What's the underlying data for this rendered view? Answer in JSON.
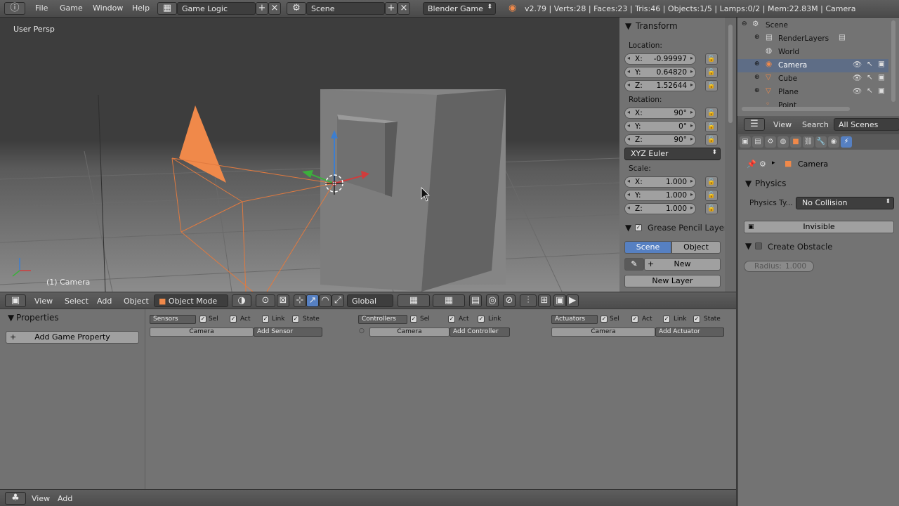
{
  "topbar": {
    "menus": [
      "File",
      "Game",
      "Window",
      "Help"
    ],
    "screen_layout": "Game Logic",
    "scene": "Scene",
    "engine": "Blender Game",
    "status": "v2.79 | Verts:28 | Faces:23 | Tris:46 | Objects:1/5 | Lamps:0/2 | Mem:22.83M | Camera"
  },
  "viewport": {
    "view_label": "User Persp",
    "object_label": "(1) Camera"
  },
  "transform_panel": {
    "title": "Transform",
    "location_label": "Location:",
    "location": [
      {
        "axis": "X:",
        "value": "-0.99997"
      },
      {
        "axis": "Y:",
        "value": "0.64820"
      },
      {
        "axis": "Z:",
        "value": "1.52644"
      }
    ],
    "rotation_label": "Rotation:",
    "rotation": [
      {
        "axis": "X:",
        "value": "90°"
      },
      {
        "axis": "Y:",
        "value": "0°"
      },
      {
        "axis": "Z:",
        "value": "90°"
      }
    ],
    "rotation_mode": "XYZ Euler",
    "scale_label": "Scale:",
    "scale": [
      {
        "axis": "X:",
        "value": "1.000"
      },
      {
        "axis": "Y:",
        "value": "1.000"
      },
      {
        "axis": "Z:",
        "value": "1.000"
      }
    ]
  },
  "grease_pencil": {
    "title": "Grease Pencil Layers",
    "scene_tab": "Scene",
    "object_tab": "Object",
    "new_label": "New",
    "new_layer_label": "New Layer"
  },
  "viewport_header": {
    "menus": [
      "View",
      "Select",
      "Add",
      "Object"
    ],
    "mode": "Object Mode",
    "orientation": "Global"
  },
  "logic_editor": {
    "properties_title": "Properties",
    "add_property": "Add Game Property",
    "sensors": {
      "label": "Sensors",
      "checks": [
        "Sel",
        "Act",
        "Link",
        "State"
      ],
      "object": "Camera",
      "add": "Add Sensor"
    },
    "controllers": {
      "label": "Controllers",
      "checks": [
        "Sel",
        "Act",
        "Link"
      ],
      "object": "Camera",
      "add": "Add Controller"
    },
    "actuators": {
      "label": "Actuators",
      "checks": [
        "Sel",
        "Act",
        "Link",
        "State"
      ],
      "object": "Camera",
      "add": "Add Actuator"
    }
  },
  "bottombar": {
    "menus": [
      "View",
      "Add"
    ]
  },
  "outliner": {
    "rows": [
      "Scene",
      "RenderLayers",
      "World",
      "Camera",
      "Cube",
      "Plane",
      "Point"
    ],
    "header_menus": [
      "View",
      "Search"
    ],
    "filter": "All Scenes"
  },
  "properties": {
    "breadcrumb": "Camera",
    "physics_title": "Physics",
    "physics_type_label": "Physics Ty...",
    "physics_type": "No Collision",
    "invisible_label": "Invisible",
    "obstacle_label": "Create Obstacle",
    "radius_label": "Radius:",
    "radius_value": "1.000"
  },
  "colors": {
    "camera_orange": "#f0894a",
    "selection_blue": "#5680c2",
    "panel_bg": "#727272",
    "header_bg": "#4a4a4a"
  }
}
